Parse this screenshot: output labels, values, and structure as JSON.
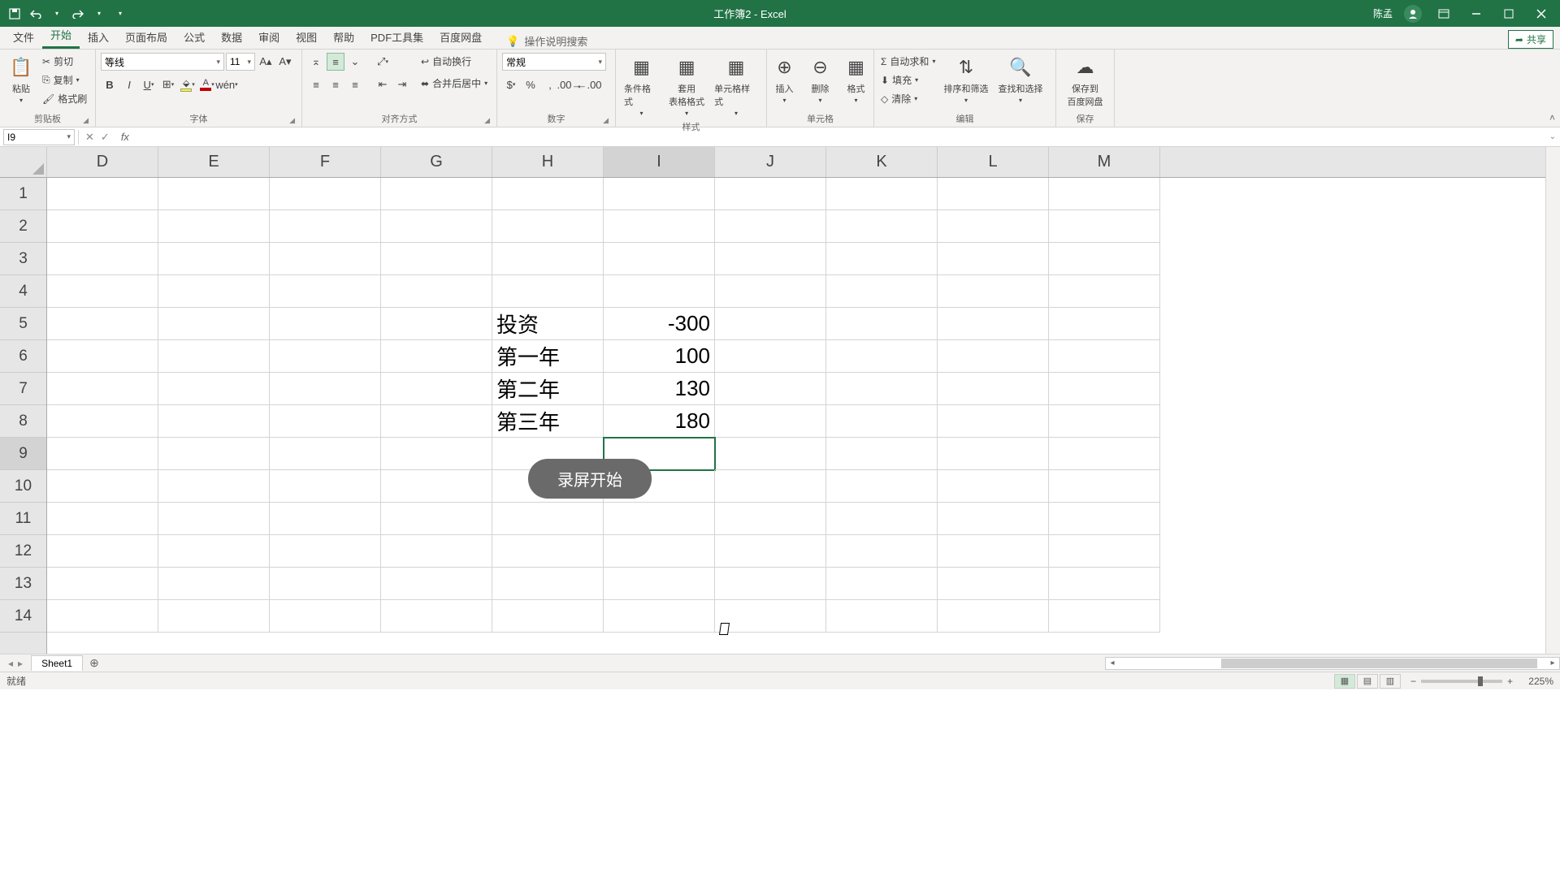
{
  "app": {
    "title": "工作簿2 - Excel",
    "user": "陈孟"
  },
  "qat": {
    "save": "保存",
    "undo": "撤销",
    "redo": "重做"
  },
  "tabs": {
    "items": [
      "文件",
      "开始",
      "插入",
      "页面布局",
      "公式",
      "数据",
      "审阅",
      "视图",
      "帮助",
      "PDF工具集",
      "百度网盘"
    ],
    "active": 1,
    "tellme": "操作说明搜索",
    "share": "共享"
  },
  "ribbon": {
    "clipboard": {
      "label": "剪贴板",
      "paste": "粘贴",
      "cut": "剪切",
      "copy": "复制",
      "painter": "格式刷"
    },
    "font": {
      "label": "字体",
      "name": "等线",
      "size": "11"
    },
    "align": {
      "label": "对齐方式",
      "wrap": "自动换行",
      "merge": "合并后居中"
    },
    "number": {
      "label": "数字",
      "format": "常规"
    },
    "styles": {
      "label": "样式",
      "cond": "条件格式",
      "table": "套用\n表格格式",
      "cell": "单元格样式"
    },
    "cells": {
      "label": "单元格",
      "insert": "插入",
      "delete": "删除",
      "format": "格式"
    },
    "editing": {
      "label": "编辑",
      "sum": "自动求和",
      "fill": "填充",
      "clear": "清除",
      "sort": "排序和筛选",
      "find": "查找和选择"
    },
    "save": {
      "label": "保存",
      "baidu": "保存到\n百度网盘"
    }
  },
  "namebox": "I9",
  "formula": "",
  "columns": [
    "D",
    "E",
    "F",
    "G",
    "H",
    "I",
    "J",
    "K",
    "L",
    "M"
  ],
  "active_col_index": 5,
  "rows": [
    "1",
    "2",
    "3",
    "4",
    "5",
    "6",
    "7",
    "8",
    "9",
    "10",
    "11",
    "12",
    "13",
    "14"
  ],
  "active_row_index": 8,
  "cells": {
    "H5": "投资",
    "I5": "-300",
    "H6": "第一年",
    "I6": "100",
    "H7": "第二年",
    "I7": "130",
    "H8": "第三年",
    "I8": "180"
  },
  "selected_cell": "I9",
  "toast": "录屏开始",
  "sheet": {
    "name": "Sheet1"
  },
  "status": {
    "ready": "就绪",
    "zoom": "225%"
  },
  "chart_data": {
    "type": "table",
    "columns": [
      "投资",
      -300
    ],
    "rows": [
      [
        "第一年",
        100
      ],
      [
        "第二年",
        130
      ],
      [
        "第三年",
        180
      ]
    ]
  }
}
